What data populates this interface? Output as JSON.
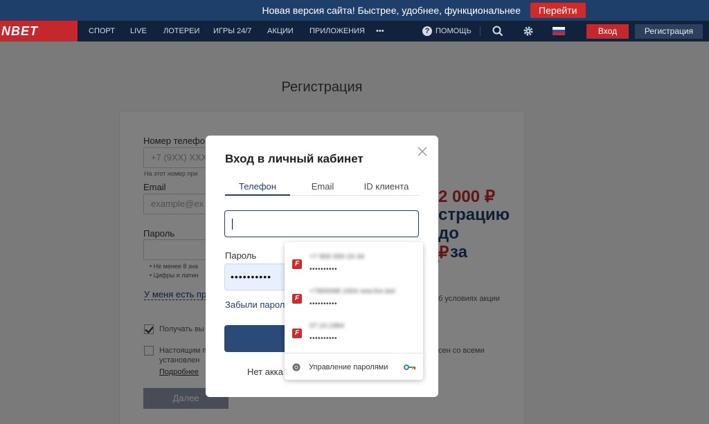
{
  "banner": {
    "text": "Новая версия сайта! Быстрее, удобнее, функциональнее",
    "button": "Перейти"
  },
  "nav": {
    "logo": "NBET",
    "items": [
      "СПОРТ",
      "LIVE",
      "ЛОТЕРЕИ",
      "ИГРЫ 24/7",
      "АКЦИИ",
      "ПРИЛОЖЕНИЯ",
      "•••"
    ],
    "help": "ПОМОЩЬ",
    "login": "Вход",
    "register": "Регистрация",
    "icons": [
      "help-icon",
      "search-icon",
      "gear-icon",
      "flag-ru-icon"
    ]
  },
  "registration": {
    "title": "Регистрация",
    "phone_label": "Номер телефо",
    "phone_placeholder": "+7 (9XX) XXX",
    "phone_hint": "На этот номер при",
    "email_label": "Email",
    "email_placeholder": "example@ex",
    "password_label": "Пароль",
    "rules": [
      "Не менее 8 зна",
      "Цифры и латин"
    ],
    "promo_code_link": "У меня есть пр",
    "checkbox1": "Получать вы",
    "checkbox2_line1": "Настоящим п",
    "checkbox2_line2": "установлен",
    "checkbox2_tail": "сен со всеми",
    "more_link": "Подробнее",
    "next_button": "Далее",
    "promo_line1": "2 000 ₽",
    "promo_line2": "страцию",
    "promo_line3": "до",
    "promo_line4a": "₽",
    "promo_line4b": "за",
    "promo_line5": "•",
    "promo_terms": "б условиях акции"
  },
  "modal": {
    "title": "Вход в личный кабинет",
    "tabs": [
      "Телефон",
      "Email",
      "ID клиента"
    ],
    "password_label": "Пароль",
    "password_value": "••••••••••",
    "forgot": "Забыли парол",
    "no_account": "Нет акка"
  },
  "autofill": {
    "entries": [
      {
        "user": "+7 900 000-16-34",
        "password": "••••••••••"
      },
      {
        "user": "+7900098 1004  new.fon.bet",
        "password": "••••••••••"
      },
      {
        "user": "07.10.1984",
        "password": "••••••••••"
      }
    ],
    "manage": "Управление паролями"
  },
  "colors": {
    "brand_red": "#c4282c",
    "navy": "#1f3f6b",
    "nav_bg": "#11223c"
  }
}
